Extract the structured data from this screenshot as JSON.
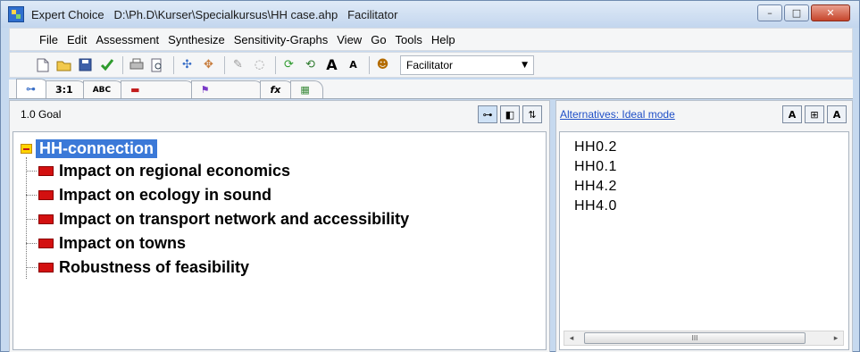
{
  "window": {
    "app_name": "Expert Choice",
    "file_path": "D:\\Ph.D\\Kurser\\Specialkursus\\HH case.ahp",
    "mode": "Facilitator",
    "controls": {
      "minimize": "–",
      "maximize": "□",
      "close": "✕"
    }
  },
  "menu": [
    "File",
    "Edit",
    "Assessment",
    "Synthesize",
    "Sensitivity-Graphs",
    "View",
    "Go",
    "Tools",
    "Help"
  ],
  "toolbar": {
    "user_mode_value": "Facilitator",
    "icons": [
      "new-file-icon",
      "open-folder-icon",
      "save-icon",
      "check-icon",
      "print-icon",
      "print-preview-icon",
      "insert-child-icon",
      "insert-sibling-icon",
      "edit-icon",
      "refresh-icon",
      "refresh-all-icon",
      "font-larger-icon",
      "font-smaller-icon",
      "users-icon"
    ]
  },
  "tabs": [
    {
      "label": "⊶",
      "icon": "tree-view-icon"
    },
    {
      "label": "3:1",
      "icon": "numerical-compare-icon"
    },
    {
      "label": "ABC",
      "icon": "verbal-compare-icon"
    },
    {
      "label": "▬",
      "icon": "graphical-compare-icon"
    },
    {
      "label": "⚑",
      "icon": "ratings-icon"
    },
    {
      "label": "fx",
      "icon": "formula-icon"
    },
    {
      "label": "▦",
      "icon": "data-grid-icon"
    }
  ],
  "left_panel": {
    "node_label": "1.0 Goal",
    "view_buttons": [
      "⊶",
      "◧",
      "⇅"
    ],
    "root": "HH-connection",
    "criteria": [
      "Impact on regional economics",
      "Impact on ecology in sound",
      "Impact on transport network and accessibility",
      "Impact on towns",
      "Robustness of feasibility"
    ]
  },
  "right_panel": {
    "title_link": "Alternatives: Ideal mode",
    "buttons": [
      "A",
      "⊞",
      "A"
    ],
    "alternatives": [
      "HH0.2",
      "HH0.1",
      "HH4.2",
      "HH4.0"
    ],
    "scrollbar": {
      "left": "◂",
      "right": "▸",
      "grip": "III"
    }
  }
}
